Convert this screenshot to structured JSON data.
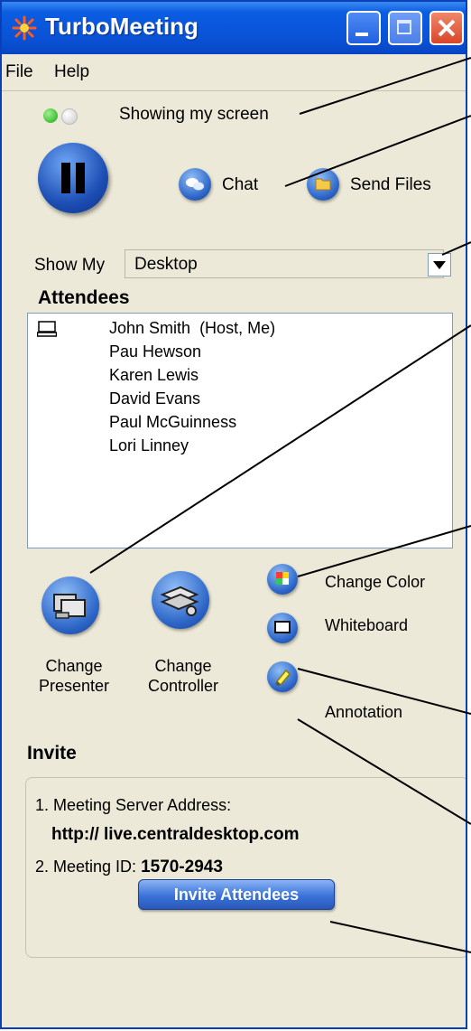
{
  "window": {
    "title": "TurboMeeting",
    "colors": {
      "titlebar": "#0a52d6",
      "frame": "#0a3fb8",
      "panel": "#ece9d8",
      "accent": "#2d66c8"
    }
  },
  "menu": {
    "items": [
      "File",
      "Help"
    ]
  },
  "status": {
    "text": "Showing my screen"
  },
  "actions": {
    "chat_label": "Chat",
    "send_files_label": "Send Files"
  },
  "show_my": {
    "label": "Show My",
    "value": "Desktop"
  },
  "attendees": {
    "heading": "Attendees",
    "list": [
      {
        "name": "John Smith",
        "role": "(Host, Me)"
      },
      {
        "name": "Pau Hewson",
        "role": ""
      },
      {
        "name": "Karen Lewis",
        "role": ""
      },
      {
        "name": "David Evans",
        "role": ""
      },
      {
        "name": "Paul McGuinness",
        "role": ""
      },
      {
        "name": "Lori Linney",
        "role": ""
      }
    ]
  },
  "tools": {
    "change_presenter": {
      "line1": "Change",
      "line2": "Presenter"
    },
    "change_controller": {
      "line1": "Change",
      "line2": "Controller"
    },
    "change_color_label": "Change Color",
    "whiteboard_label": "Whiteboard",
    "annotation_label": "Annotation"
  },
  "invite": {
    "heading": "Invite",
    "server_label": "1. Meeting Server Address:",
    "server_value": "http:// live.centraldesktop.com",
    "meeting_id_label": "2. Meeting ID: ",
    "meeting_id_value": "1570-2943",
    "button_label": "Invite Attendees"
  },
  "icons": {
    "app": "turbomeeting-logo-icon",
    "pause": "pause-icon",
    "chat": "chat-bubble-icon",
    "send_files": "folder-icon",
    "dropdown": "chevron-down-icon",
    "attendee_host": "monitor-icon",
    "presenter": "presenter-icon",
    "controller": "controller-icon",
    "change_color": "color-palette-icon",
    "whiteboard": "whiteboard-icon",
    "annotation": "highlighter-icon"
  }
}
